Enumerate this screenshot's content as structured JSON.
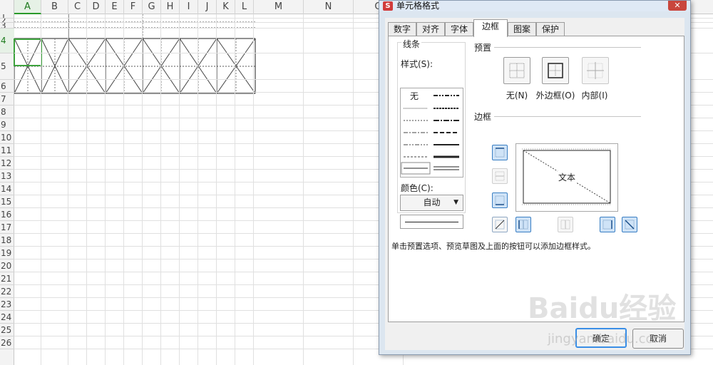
{
  "spreadsheet": {
    "columns": [
      "A",
      "B",
      "C",
      "D",
      "E",
      "F",
      "G",
      "H",
      "I",
      "J",
      "K",
      "L",
      "M",
      "N",
      "O"
    ],
    "active_column": "A",
    "rows": [
      "1",
      "2",
      "3",
      "4",
      "5",
      "6",
      "7",
      "8",
      "9",
      "10",
      "11",
      "12",
      "13",
      "14",
      "15",
      "16",
      "17",
      "18",
      "19",
      "20",
      "21",
      "22",
      "23",
      "24",
      "25",
      "26"
    ],
    "active_row": "4",
    "selection_color": "#3da23d"
  },
  "dialog": {
    "logo": "S",
    "title": "单元格格式",
    "close": "✕",
    "tabs": [
      "数字",
      "对齐",
      "字体",
      "边框",
      "图案",
      "保护"
    ],
    "active_tab": "边框",
    "line_group": "线条",
    "style_label": "样式(S):",
    "style_none": "无",
    "color_label": "颜色(C):",
    "color_value": "自动",
    "presets_group": "预置",
    "presets": [
      "无(N)",
      "外边框(O)",
      "内部(I)"
    ],
    "border_group": "边框",
    "preview_text": "文本",
    "hint": "单击预置选项、预览草图及上面的按钮可以添加边框样式。",
    "ok_button": "确定",
    "cancel_button": "取消"
  },
  "watermark": {
    "text": "Baidu经验",
    "url": "jingyan.baidu.com"
  }
}
